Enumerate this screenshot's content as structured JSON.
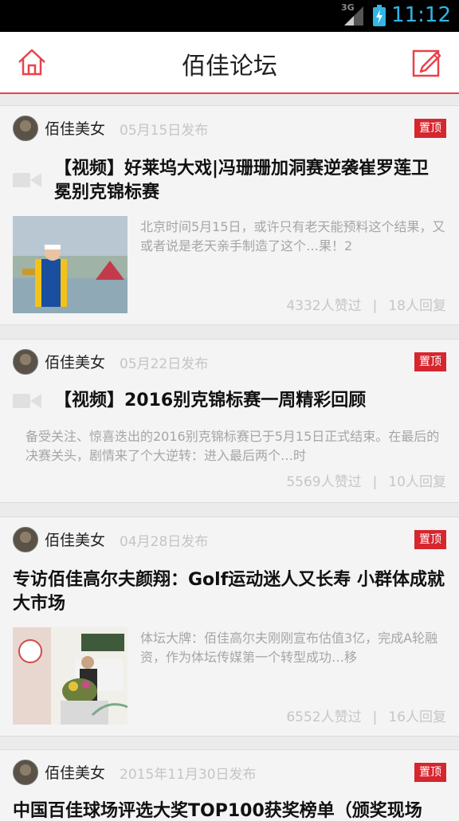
{
  "status_bar": {
    "time": "11:12",
    "network": "3G"
  },
  "header": {
    "title": "佰佳论坛"
  },
  "posts": [
    {
      "author": "佰佳美女",
      "date": "05月15日发布",
      "badge": "置顶",
      "title": "【视频】好莱坞大戏|冯珊珊加洞赛逆袭崔罗莲卫冕别克锦标赛",
      "excerpt": "北京时间5月15日，或许只有老天能预料这个结果，又或者说是老天亲手制造了这个…果！2",
      "likes": "4332人赞过",
      "sep": "|",
      "replies": "18人回复"
    },
    {
      "author": "佰佳美女",
      "date": "05月22日发布",
      "badge": "置顶",
      "title": "【视频】2016别克锦标赛一周精彩回顾",
      "excerpt": "备受关注、惊喜迭出的2016别克锦标赛已于5月15日正式结束。在最后的决赛关头，剧情来了个大逆转：进入最后两个…时",
      "likes": "5569人赞过",
      "sep": "|",
      "replies": "10人回复"
    },
    {
      "author": "佰佳美女",
      "date": "04月28日发布",
      "badge": "置顶",
      "title": "专访佰佳高尔夫颜翔：Golf运动迷人又长寿 小群体成就大市场",
      "excerpt": "体坛大牌：佰佳高尔夫刚刚宣布估值3亿，完成A轮融资，作为体坛传媒第一个转型成功…移",
      "likes": "6552人赞过",
      "sep": "|",
      "replies": "16人回复"
    },
    {
      "author": "佰佳美女",
      "date": "2015年11月30日发布",
      "badge": "置顶",
      "title": "中国百佳球场评选大奖TOP100获奖榜单（颁奖现场"
    }
  ],
  "colors": {
    "accent": "#e9424a",
    "badge": "#d6262e"
  }
}
